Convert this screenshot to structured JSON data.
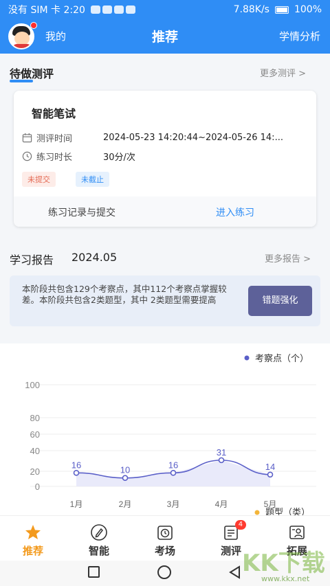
{
  "status_bar": {
    "left_text": "没有 SIM 卡 2:20",
    "speed": "7.88K/s",
    "battery": "100%"
  },
  "top_nav": {
    "mine_label": "我的",
    "title": "推荐",
    "right_label": "学情分析"
  },
  "pending": {
    "title": "待做测评",
    "more": "更多测评 >",
    "card": {
      "name": "智能笔试",
      "time_label": "测评时间",
      "time_value": "2024-05-23 14:20:44~2024-05-26 14:...",
      "duration_label": "练习时长",
      "duration_value": "30分/次",
      "tag_unsubmitted": "未提交",
      "tag_open": "未截止",
      "footer_records": "练习记录与提交",
      "footer_enter": "进入练习"
    }
  },
  "report": {
    "title": "学习报告",
    "date": "2024.05",
    "more": "更多报告 >",
    "summary": "本阶段共包含129个考察点，其中112个考察点掌握较差。本阶段共包含2类题型，其中 2类题型需要提高",
    "button": "错题强化"
  },
  "chart_data": {
    "type": "line",
    "legend_top": "考察点（个）",
    "legend_bottom": "题型（类）",
    "categories": [
      "1月",
      "2月",
      "3月",
      "4月",
      "5月"
    ],
    "series": [
      {
        "name": "考察点（个）",
        "values": [
          16,
          10,
          16,
          31,
          14
        ]
      }
    ],
    "y_ticks": [
      "100",
      "80",
      "60",
      "40",
      "20",
      "0"
    ],
    "colors": {
      "line": "#5a5fc8",
      "fill": "#e9eafa",
      "legend_bottom_dot": "#f3b53a"
    }
  },
  "tab_bar": {
    "tabs": [
      {
        "label": "推荐",
        "icon": "star-icon"
      },
      {
        "label": "智能",
        "icon": "pen-icon"
      },
      {
        "label": "考场",
        "icon": "clock-icon"
      },
      {
        "label": "测评",
        "icon": "document-icon",
        "badge": "4"
      },
      {
        "label": "拓展",
        "icon": "person-card-icon"
      }
    ]
  },
  "watermark": {
    "text": "KK下载",
    "url": "www.kkx.net"
  },
  "colors": {
    "primary": "#2f8df5",
    "accent": "#f39a1d",
    "button": "#5d6199"
  }
}
